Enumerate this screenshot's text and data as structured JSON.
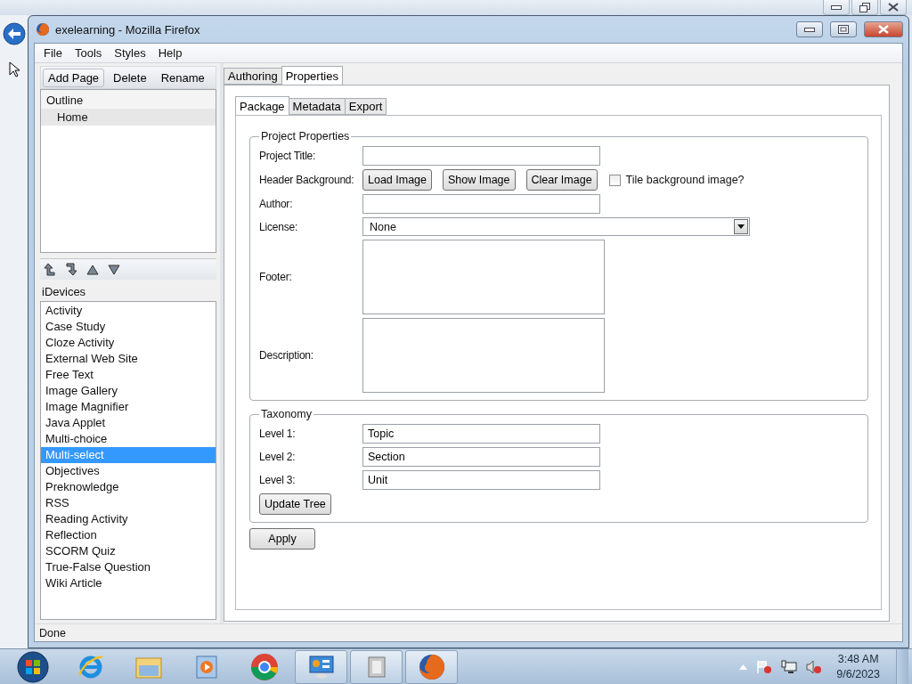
{
  "window": {
    "title": "exelearning - Mozilla Firefox"
  },
  "menu": [
    {
      "label": "File"
    },
    {
      "label": "Tools"
    },
    {
      "label": "Styles"
    },
    {
      "label": "Help"
    }
  ],
  "outline_toolbar": [
    {
      "label": "Add Page",
      "kind": "button"
    },
    {
      "label": "Delete",
      "kind": "link"
    },
    {
      "label": "Rename",
      "kind": "link"
    }
  ],
  "outline": {
    "title": "Outline",
    "items": [
      {
        "label": "Home",
        "selected": true
      }
    ]
  },
  "idevices": {
    "title": "iDevices",
    "items": [
      {
        "label": "Activity",
        "selected": false
      },
      {
        "label": "Case Study",
        "selected": false
      },
      {
        "label": "Cloze Activity",
        "selected": false
      },
      {
        "label": "External Web Site",
        "selected": false
      },
      {
        "label": "Free Text",
        "selected": false
      },
      {
        "label": "Image Gallery",
        "selected": false
      },
      {
        "label": "Image Magnifier",
        "selected": false
      },
      {
        "label": "Java Applet",
        "selected": false
      },
      {
        "label": "Multi-choice",
        "selected": false
      },
      {
        "label": "Multi-select",
        "selected": true
      },
      {
        "label": "Objectives",
        "selected": false
      },
      {
        "label": "Preknowledge",
        "selected": false
      },
      {
        "label": "RSS",
        "selected": false
      },
      {
        "label": "Reading Activity",
        "selected": false
      },
      {
        "label": "Reflection",
        "selected": false
      },
      {
        "label": "SCORM Quiz",
        "selected": false
      },
      {
        "label": "True-False Question",
        "selected": false
      },
      {
        "label": "Wiki Article",
        "selected": false
      }
    ]
  },
  "tabs": [
    {
      "label": "Authoring",
      "selected": false
    },
    {
      "label": "Properties",
      "selected": true
    }
  ],
  "subtabs": [
    {
      "label": "Package",
      "selected": true
    },
    {
      "label": "Metadata",
      "selected": false
    },
    {
      "label": "Export",
      "selected": false
    }
  ],
  "project_properties": {
    "title": "Project Properties",
    "rows": [
      {
        "kind": "text",
        "label": "Project Title:"
      },
      {
        "kind": "image",
        "label": "Header Background:",
        "buttons": [
          "Load Image",
          "Show Image",
          "Clear Image"
        ],
        "checkbox": {
          "label": "Tile background image?",
          "checked": false
        }
      },
      {
        "kind": "text",
        "label": "Author:"
      },
      {
        "kind": "select",
        "label": "License:",
        "value": "None"
      },
      {
        "kind": "textarea",
        "label": "Footer:"
      },
      {
        "kind": "textarea",
        "label": "Description:"
      }
    ]
  },
  "taxonomy": {
    "title": "Taxonomy",
    "rows": [
      {
        "label": "Level 1:",
        "value": "Topic"
      },
      {
        "label": "Level 2:",
        "value": "Section"
      },
      {
        "label": "Level 3:",
        "value": "Unit"
      }
    ],
    "button": "Update Tree"
  },
  "apply_button": "Apply",
  "status_bar": "Done",
  "clock": {
    "time": "3:48 AM",
    "date": "9/6/2023"
  }
}
